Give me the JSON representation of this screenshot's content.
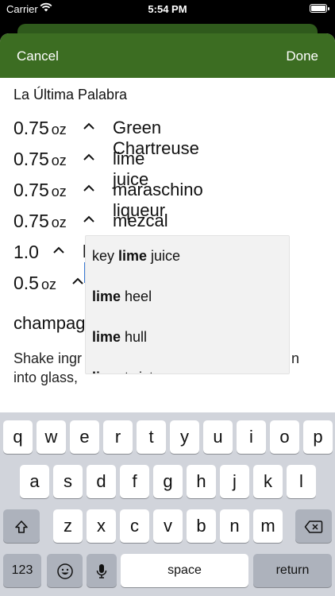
{
  "status": {
    "carrier": "Carrier",
    "time": "5:54 PM"
  },
  "nav": {
    "cancel": "Cancel",
    "done": "Done"
  },
  "recipe": {
    "title": "La Última Palabra",
    "ingredients": [
      {
        "amount": "0.75",
        "unit": "oz",
        "name": "Green Chartreuse"
      },
      {
        "amount": "0.75",
        "unit": "oz",
        "name": "lime juice"
      },
      {
        "amount": "0.75",
        "unit": "oz",
        "name": "maraschino liqueur"
      },
      {
        "amount": "0.75",
        "unit": "oz",
        "name": "mezcal"
      },
      {
        "amount": "1.0",
        "unit": "",
        "name": "lime"
      },
      {
        "amount": "0.5",
        "unit": "oz",
        "name": ""
      }
    ],
    "garnish_partial": "champag",
    "instructions_line1": "Shake ingr",
    "instructions_line1_end": "n",
    "instructions_line2": "into glass,"
  },
  "suggestions": [
    {
      "pre": "key ",
      "match": "lime",
      "post": " juice"
    },
    {
      "pre": "",
      "match": "lime",
      "post": " heel"
    },
    {
      "pre": "",
      "match": "lime",
      "post": " hull"
    },
    {
      "pre": "",
      "match": "lime",
      "post": " twist"
    }
  ],
  "keyboard": {
    "row1": [
      "q",
      "w",
      "e",
      "r",
      "t",
      "y",
      "u",
      "i",
      "o",
      "p"
    ],
    "row2": [
      "a",
      "s",
      "d",
      "f",
      "g",
      "h",
      "j",
      "k",
      "l"
    ],
    "row3": [
      "z",
      "x",
      "c",
      "v",
      "b",
      "n",
      "m"
    ],
    "numbers_key": "123",
    "space_key": "space",
    "return_key": "return"
  },
  "colors": {
    "nav_green": "#3c6d22",
    "caret_blue": "#3a7bd5"
  }
}
